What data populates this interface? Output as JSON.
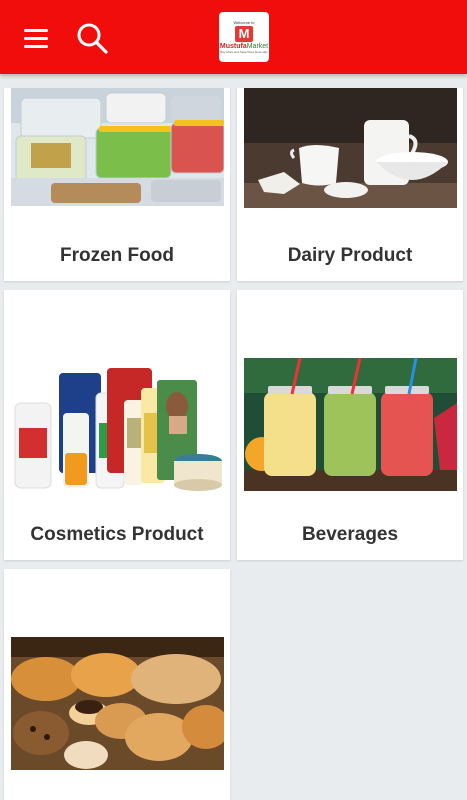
{
  "appbar": {
    "menu_icon": "hamburger-menu-icon",
    "search_icon": "search-icon",
    "logo": {
      "tagline_top": "Welcome to",
      "mark": "M",
      "name_part1": "Mustufa",
      "name_part2": "Market",
      "tagline_bottom": "Buy More and Save More Everyday"
    },
    "colors": {
      "primary": "#f20d0d"
    }
  },
  "categories": [
    {
      "label": "Frozen Food",
      "image": "frozen-food-containers-image"
    },
    {
      "label": "Dairy Product",
      "image": "dairy-products-image"
    },
    {
      "label": "Cosmetics Product",
      "image": "cosmetics-products-image"
    },
    {
      "label": "Beverages",
      "image": "fruit-juices-jars-image"
    },
    {
      "label": "",
      "image": "bakery-pastries-image"
    }
  ]
}
